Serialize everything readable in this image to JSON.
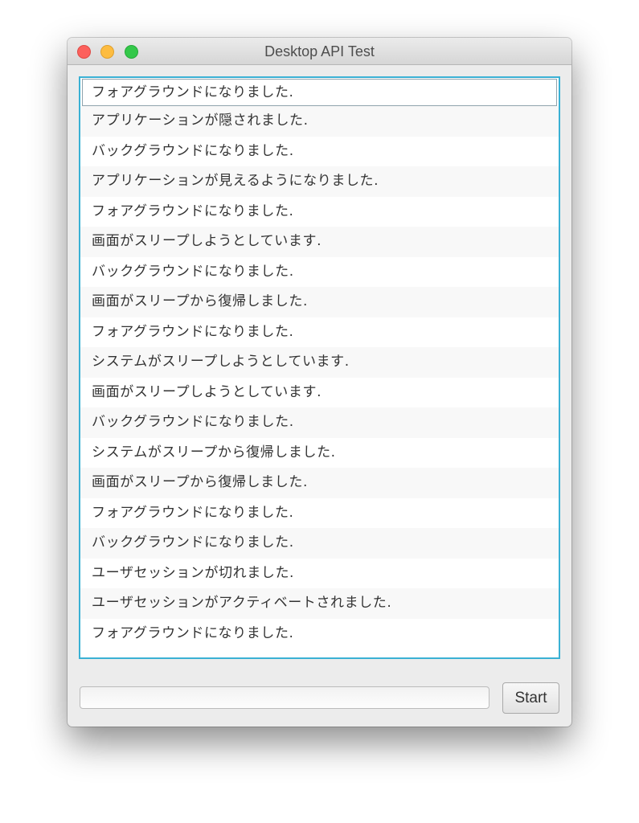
{
  "window": {
    "title": "Desktop API Test"
  },
  "log": {
    "items": [
      "フォアグラウンドになりました.",
      "アプリケーションが隠されました.",
      "バックグラウンドになりました.",
      "アプリケーションが見えるようになりました.",
      "フォアグラウンドになりました.",
      "画面がスリープしようとしています.",
      "バックグラウンドになりました.",
      "画面がスリープから復帰しました.",
      "フォアグラウンドになりました.",
      "システムがスリープしようとしています.",
      "画面がスリープしようとしています.",
      "バックグラウンドになりました.",
      "システムがスリープから復帰しました.",
      "画面がスリープから復帰しました.",
      "フォアグラウンドになりました.",
      "バックグラウンドになりました.",
      "ユーザセッションが切れました.",
      "ユーザセッションがアクティベートされました.",
      "フォアグラウンドになりました."
    ],
    "selected_index": 0
  },
  "progress": {
    "value": 0
  },
  "controls": {
    "start_label": "Start"
  },
  "colors": {
    "focus_ring": "#3ab1d4",
    "close": "#fc605c",
    "minimize": "#fdbc40",
    "maximize": "#34c84a"
  }
}
